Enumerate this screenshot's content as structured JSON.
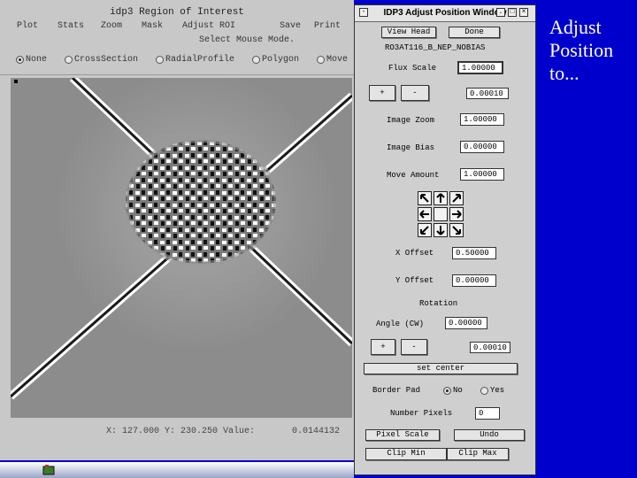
{
  "roi_window": {
    "title": "idp3 Region of Interest",
    "menu": [
      "Plot",
      "Stats",
      "Zoom",
      "Mask",
      "Adjust ROI",
      "Save",
      "Print"
    ],
    "hint": "Select Mouse Mode.",
    "modes": [
      {
        "label": "None",
        "selected": true
      },
      {
        "label": "CrossSection",
        "selected": false
      },
      {
        "label": "RadialProfile",
        "selected": false
      },
      {
        "label": "Polygon",
        "selected": false
      },
      {
        "label": "Move",
        "selected": false
      }
    ],
    "readout": "X: 127.000 Y: 230.250 Value:       0.0144132"
  },
  "adjust_window": {
    "title": "IDP3 Adjust Position Window",
    "titlebar_icons": [
      "minimize-icon",
      "maximize-icon",
      "close-icon"
    ],
    "view_head_label": "View Head",
    "done_label": "Done",
    "image_name": "RO3AT116_B_NEP_NOBIAS",
    "flux_scale": {
      "label": "Flux Scale",
      "value": "1.00000"
    },
    "flux_plus": "+",
    "flux_minus": "-",
    "flux_step": "0.00010",
    "image_zoom": {
      "label": "Image Zoom",
      "value": "1.00000"
    },
    "image_bias": {
      "label": "Image Bias",
      "value": "0.00000"
    },
    "move_amount": {
      "label": "Move Amount",
      "value": "1.00000"
    },
    "x_offset": {
      "label": "X Offset",
      "value": "0.50000"
    },
    "y_offset": {
      "label": "Y Offset",
      "value": "0.00000"
    },
    "rotation_label": "Rotation",
    "angle": {
      "label": "Angle (CW)",
      "value": "0.00000"
    },
    "angle_plus": "+",
    "angle_minus": "-",
    "angle_step": "0.00010",
    "set_center_label": "set center",
    "border_pad": {
      "label": "Border Pad",
      "options": [
        {
          "label": "No",
          "selected": true
        },
        {
          "label": "Yes",
          "selected": false
        }
      ]
    },
    "number_pixels": {
      "label": "Number Pixels",
      "value": "0"
    },
    "pixel_scale_label": "Pixel Scale",
    "undo_label": "Undo",
    "clip_min_label": "Clip Min",
    "clip_max_label": "Clip Max",
    "arrow_icons": [
      "arrow-up-left-icon",
      "arrow-up-icon",
      "arrow-up-right-icon",
      "arrow-left-icon",
      "center-icon",
      "arrow-right-icon",
      "arrow-down-left-icon",
      "arrow-down-icon",
      "arrow-down-right-icon"
    ]
  },
  "caption": {
    "text": "Adjust Position to..."
  },
  "colors": {
    "background": "#0000cc",
    "window": "#c8c8c8",
    "caption": "#ffffff"
  }
}
